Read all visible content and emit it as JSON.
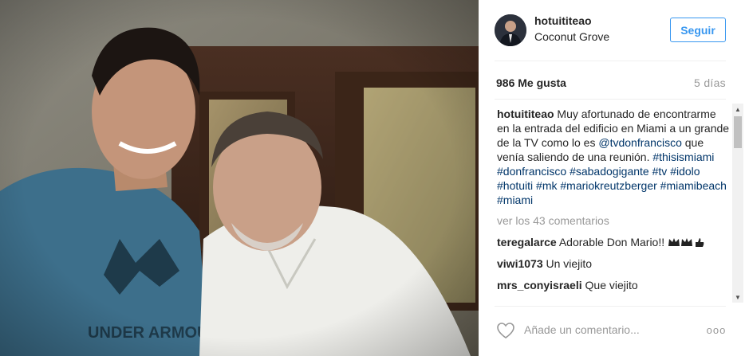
{
  "header": {
    "username": "hotuititeao",
    "location": "Coconut Grove",
    "follow_label": "Seguir"
  },
  "stats": {
    "likes": "986 Me gusta",
    "age": "5 días"
  },
  "caption": {
    "username": "hotuititeao",
    "text_1": " Muy afortunado de encontrarme en la entrada del edificio en Miami a un grande de la TV como lo es ",
    "mention": "@tvdonfrancisco",
    "text_2": " que venía saliendo de una reunión. ",
    "hashtags": [
      "#thisismiami",
      "#donfrancisco",
      "#sabadogigante",
      "#tv",
      "#idolo",
      "#hotuiti",
      "#mk",
      "#mariokreutzberger",
      "#miamibeach",
      "#miami"
    ]
  },
  "view_all": "ver los 43 comentarios",
  "comments": [
    {
      "user": "teregalarce",
      "text": " Adorable Don Mario!!"
    },
    {
      "user": "viwi1073",
      "text": " Un viejito"
    },
    {
      "user": "mrs_conyisraeli",
      "text": " Que viejito"
    }
  ],
  "footer": {
    "comment_placeholder": "Añade un comentario...",
    "more_label": "ooo"
  },
  "icons": {
    "like": "heart-icon",
    "more": "more-options-icon",
    "comment_emoji_1": "crown-icon",
    "comment_emoji_2": "crown-icon",
    "comment_emoji_3": "thumbs-up-icon"
  }
}
